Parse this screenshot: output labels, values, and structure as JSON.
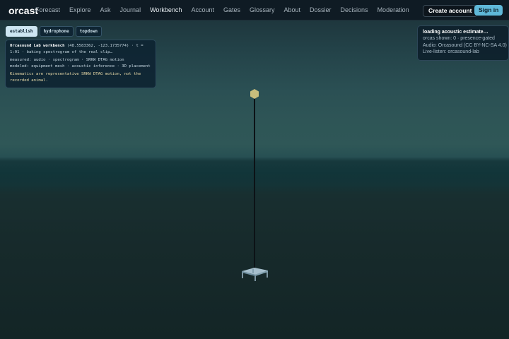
{
  "nav": {
    "brand": "orcast",
    "links": [
      {
        "label": "Forecast"
      },
      {
        "label": "Explore"
      },
      {
        "label": "Ask"
      },
      {
        "label": "Journal"
      },
      {
        "label": "Workbench",
        "active": true
      },
      {
        "label": "Account"
      },
      {
        "label": "Gates"
      },
      {
        "label": "Glossary"
      },
      {
        "label": "About"
      },
      {
        "label": "Dossier"
      },
      {
        "label": "Decisions"
      },
      {
        "label": "Moderation"
      }
    ],
    "create_account": "Create account",
    "sign_in": "Sign in"
  },
  "camera_tabs": [
    {
      "label": "establish",
      "active": true
    },
    {
      "label": "hydrophone"
    },
    {
      "label": "topdown"
    }
  ],
  "info": {
    "title": "Orcasound Lab workbench",
    "coords": "(48.5583362, -123.1735774) · t = 1:01 · baking spectrogram of the real clip…",
    "measured": "measured: audio · spectrogram · SRKW DTAG motion",
    "modeled": "modeled: equipment mesh · acoustic inference · 3D placement",
    "note": "Kinematics are representative SRKW DTAG motion, not the recorded animal."
  },
  "status": {
    "loading": "loading acoustic estimate…",
    "orcas_shown": "orcas shown: 0 · presence-gated",
    "audio": "Audio: Orcasound (CC BY-NC-SA 4.0)",
    "live_listen": "Live-listen: orcasound-lab"
  },
  "colors": {
    "accent": "#5fb8d8",
    "buoy": "#c8bd7c",
    "platform": "#9fb9c8"
  }
}
